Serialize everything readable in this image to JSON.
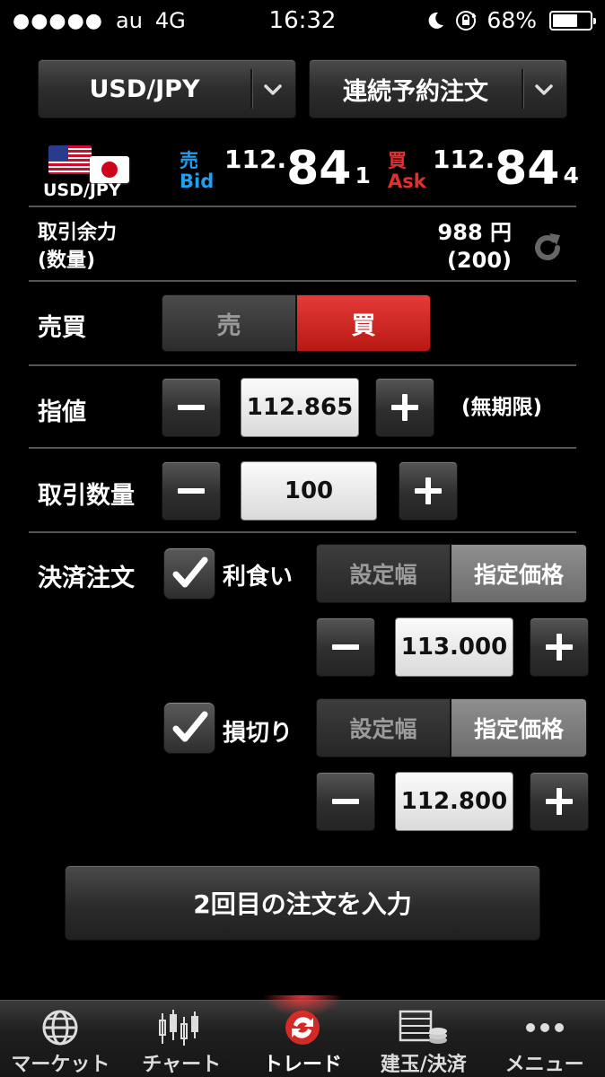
{
  "status_bar": {
    "signal_dots": "●●●●●",
    "carrier": "au",
    "network": "4G",
    "time": "16:32",
    "battery_percent": "68%",
    "battery_level": 0.68
  },
  "selectors": {
    "pair": "USD/JPY",
    "order_type": "連続予約注文"
  },
  "quote": {
    "pair_label": "USD/JPY",
    "bid_label_jp": "売",
    "bid_label_en": "Bid",
    "bid_prefix": "112.",
    "bid_big": "84",
    "bid_last": "1",
    "ask_label_jp": "買",
    "ask_label_en": "Ask",
    "ask_prefix": "112.",
    "ask_big": "84",
    "ask_last": "4"
  },
  "margin": {
    "label_line1": "取引余力",
    "label_line2": "(数量)",
    "amount": "988 円",
    "quantity": "(200)"
  },
  "side": {
    "label": "売買",
    "sell": "売",
    "buy": "買",
    "selected": "buy"
  },
  "limit": {
    "label": "指値",
    "value": "112.865",
    "expiry": "(無期限)"
  },
  "quantity": {
    "label": "取引数量",
    "value": "100"
  },
  "settlement": {
    "label": "決済注文",
    "take_profit": {
      "label": "利食い",
      "checked": true,
      "tab_width": "設定幅",
      "tab_price": "指定価格",
      "selected_tab": "指定価格",
      "value": "113.000"
    },
    "stop_loss": {
      "label": "損切り",
      "checked": true,
      "tab_width": "設定幅",
      "tab_price": "指定価格",
      "selected_tab": "指定価格",
      "value": "112.800"
    }
  },
  "next_button": "2回目の注文を入力",
  "tabbar": {
    "items": [
      {
        "label": "マーケット",
        "icon": "globe-icon"
      },
      {
        "label": "チャート",
        "icon": "candlestick-icon"
      },
      {
        "label": "トレード",
        "icon": "trade-icon",
        "active": true
      },
      {
        "label": "建玉/決済",
        "icon": "positions-icon"
      },
      {
        "label": "メニュー",
        "icon": "more-dots-icon"
      }
    ]
  },
  "colors": {
    "background": "#000000",
    "bid_blue": "#1da1f2",
    "ask_red": "#e0312e",
    "buy_active": "#d42a26"
  }
}
